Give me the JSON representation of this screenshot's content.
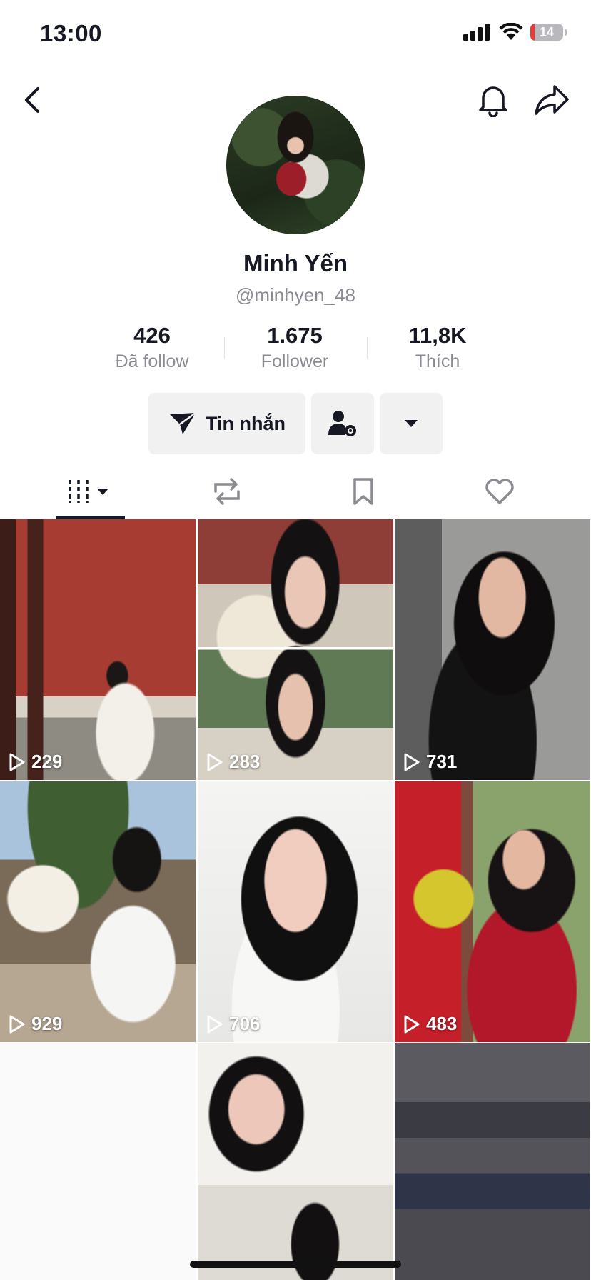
{
  "status_bar": {
    "time": "13:00",
    "battery": "14",
    "battery_level_percent": 14
  },
  "profile": {
    "display_name": "Minh Yến",
    "username": "@minhyen_48"
  },
  "stats": [
    {
      "value": "426",
      "label": "Đã follow"
    },
    {
      "value": "1.675",
      "label": "Follower"
    },
    {
      "value": "11,8K",
      "label": "Thích"
    }
  ],
  "actions": {
    "message_label": "Tin nhắn"
  },
  "tabs": [
    {
      "icon": "videos-grid-icon",
      "active": true
    },
    {
      "icon": "repost-icon",
      "active": false
    },
    {
      "icon": "bookmark-icon",
      "active": false
    },
    {
      "icon": "heart-icon",
      "active": false
    }
  ],
  "videos": [
    {
      "views": "229"
    },
    {
      "views": "283"
    },
    {
      "views": "731"
    },
    {
      "views": "929"
    },
    {
      "views": "706"
    },
    {
      "views": "483"
    }
  ],
  "colors": {
    "text": "#161823",
    "muted": "#8a8b91",
    "button_bg": "#f1f1f2",
    "battery_low": "#ea3b35"
  }
}
